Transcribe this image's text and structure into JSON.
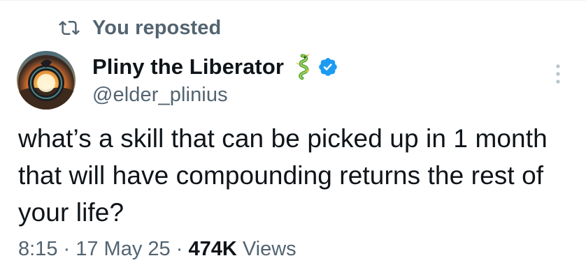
{
  "repost": {
    "label": "You reposted",
    "icon": "repost-icon"
  },
  "author": {
    "display_name": "Pliny the Liberator",
    "handle": "@elder_plinius",
    "name_emoji_icon": "dragon-icon",
    "verified_icon": "verified-badge-icon",
    "verified_color": "#1d9bf0"
  },
  "tweet": {
    "text": "what’s a skill that can be picked up in 1 month that will have compounding returns the rest of your life?"
  },
  "meta": {
    "time": "8:15",
    "separator": " · ",
    "date": "17 May 25",
    "views_count": "474K",
    "views_label": "Views"
  },
  "colors": {
    "text_primary": "#0f1419",
    "text_secondary": "#536471"
  }
}
